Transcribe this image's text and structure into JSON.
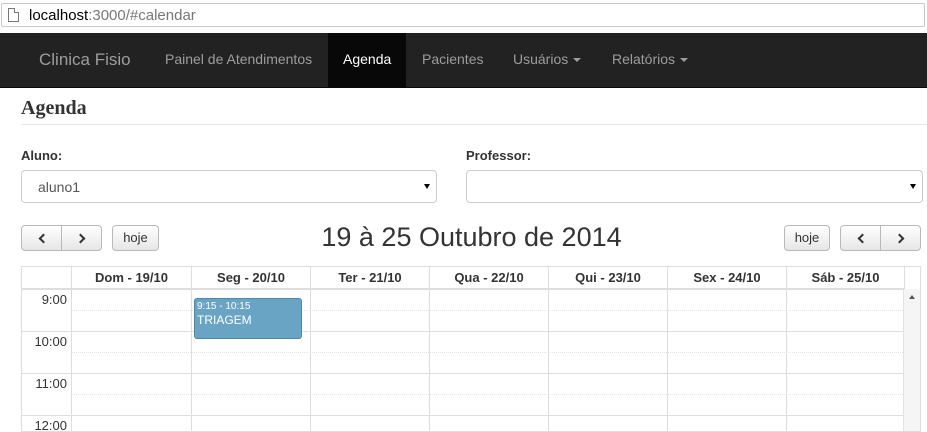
{
  "browser": {
    "url_host": "localhost",
    "url_rest": ":3000/#calendar"
  },
  "navbar": {
    "brand": "Clinica Fisio",
    "items": [
      {
        "label": "Painel de Atendimentos",
        "active": false,
        "dropdown": false
      },
      {
        "label": "Agenda",
        "active": true,
        "dropdown": false
      },
      {
        "label": "Pacientes",
        "active": false,
        "dropdown": false
      },
      {
        "label": "Usuários",
        "active": false,
        "dropdown": true
      },
      {
        "label": "Relatórios",
        "active": false,
        "dropdown": true
      }
    ]
  },
  "page": {
    "title": "Agenda"
  },
  "form": {
    "aluno_label": "Aluno:",
    "aluno_value": "aluno1",
    "professor_label": "Professor:",
    "professor_value": ""
  },
  "calendar": {
    "title": "19 à 25 Outubro de 2014",
    "today_label": "hoje",
    "days": [
      "Dom - 19/10",
      "Seg - 20/10",
      "Ter - 21/10",
      "Qua - 22/10",
      "Qui - 23/10",
      "Sex - 24/10",
      "Sáb - 25/10"
    ],
    "hours": [
      "9:00",
      "10:00",
      "11:00",
      "12:00"
    ],
    "events": [
      {
        "time": "9:15 - 10:15",
        "title": "TRIAGEM",
        "day": "Seg - 20/10",
        "color": "#6aa4c5"
      }
    ]
  },
  "colors": {
    "navbar_bg": "#222222",
    "navbar_active": "#080808",
    "event_bg": "#6aa4c5"
  }
}
